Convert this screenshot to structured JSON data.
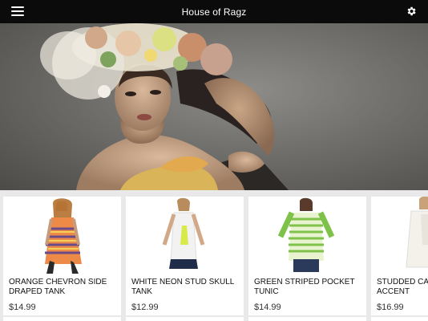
{
  "app": {
    "title": "House of Ragz",
    "menu_icon": "hamburger-menu-icon",
    "settings_icon": "gear-icon"
  },
  "hero": {
    "image": "hero-banner-model-flower-headdress"
  },
  "products": [
    {
      "name": "ORANGE CHEVRON SIDE DRAPED TANK",
      "price": "$14.99",
      "image": "orange-chevron-tank-photo"
    },
    {
      "name": "WHITE NEON STUD SKULL TANK",
      "price": "$12.99",
      "image": "white-neon-skull-tank-photo"
    },
    {
      "name": "GREEN STRIPED POCKET TUNIC",
      "price": "$14.99",
      "image": "green-striped-tunic-photo"
    },
    {
      "name": "STUDDED CARDIGAN ZIP ACCENT",
      "price": "$16.99",
      "image": "studded-cardigan-photo"
    }
  ],
  "colors": {
    "topbar": "#0b0b0b",
    "background": "#e9e9e9",
    "card": "#ffffff"
  }
}
